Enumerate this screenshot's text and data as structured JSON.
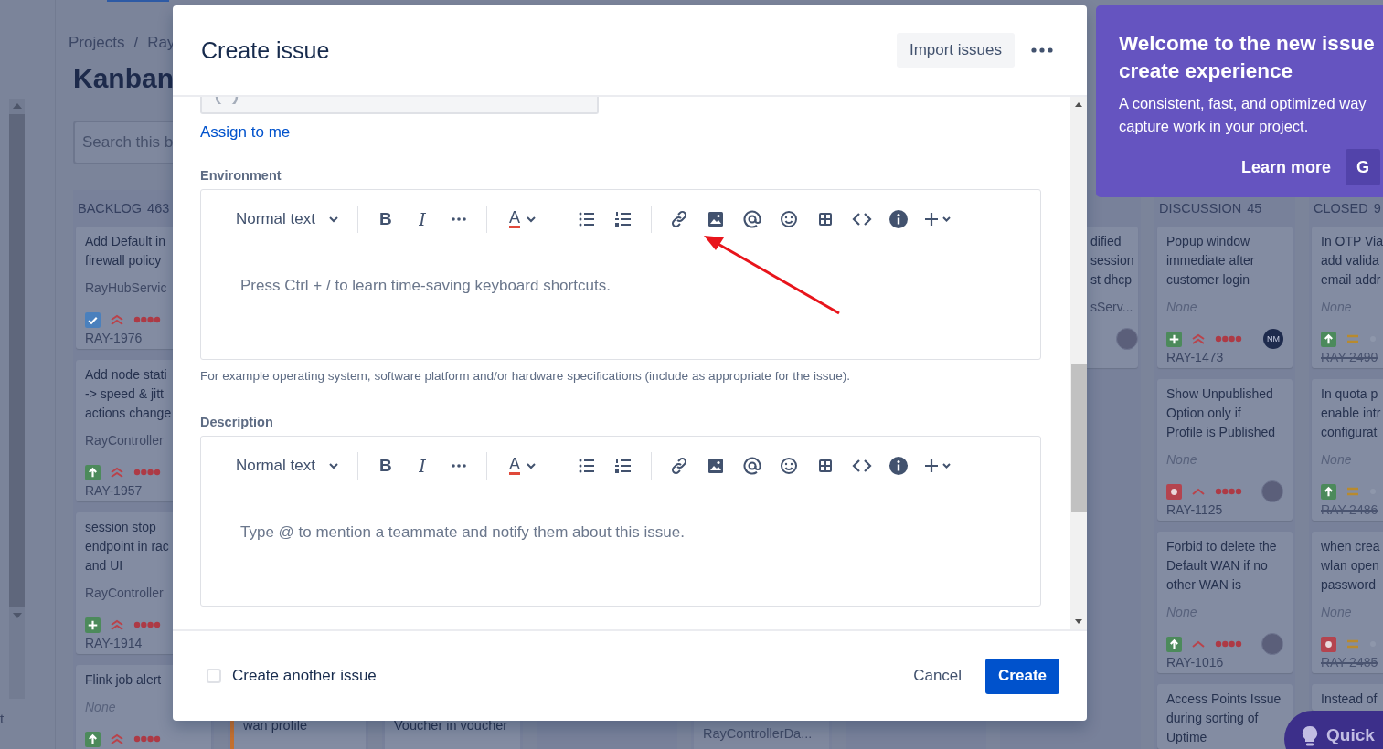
{
  "board": {
    "sidebar_fragment": "t",
    "breadcrumbs": [
      "Projects",
      "/",
      "Ray"
    ],
    "title": "Kanban",
    "search": {
      "placeholder": "Search this b"
    },
    "backlog": {
      "name": "BACKLOG",
      "count": "463",
      "cards": [
        {
          "lines": [
            "Add Default in",
            "firewall policy"
          ],
          "component": "RayHubServic",
          "component_missing": false,
          "icons": [
            {
              "kind": "task"
            },
            {
              "kind": "highest"
            },
            {
              "kind": "red_dots"
            }
          ],
          "key": "RAY-1976",
          "done": false
        },
        {
          "lines": [
            "Add node stati",
            "-> speed & jitt",
            "actions change"
          ],
          "component": "RayController",
          "component_missing": false,
          "icons": [
            {
              "kind": "improvement"
            },
            {
              "kind": "highest"
            },
            {
              "kind": "red_dots"
            }
          ],
          "key": "RAY-1957",
          "done": false
        },
        {
          "lines": [
            "session stop",
            "endpoint in rac",
            "and UI"
          ],
          "component": "RayController",
          "component_missing": false,
          "icons": [
            {
              "kind": "new_feature"
            },
            {
              "kind": "highest"
            },
            {
              "kind": "red_dots"
            }
          ],
          "key": "RAY-1914",
          "done": false
        },
        {
          "lines": [
            "Flink job alert"
          ],
          "component": "None",
          "component_missing": true,
          "icons": [
            {
              "kind": "improvement"
            },
            {
              "kind": "highest"
            },
            {
              "kind": "red_dots"
            }
          ]
        }
      ]
    },
    "covered_columns": [
      {
        "cards": [
          {
            "kind": "title",
            "text": "wan profile",
            "color": "#c4702f"
          }
        ]
      },
      {
        "cards": [
          {
            "kind": "title",
            "text": "Voucher in voucher"
          }
        ]
      },
      {},
      {
        "cards": [
          {
            "kind": "component",
            "text": "RayControllerDa..."
          }
        ]
      },
      {}
    ],
    "partial_column": {
      "cards": [
        {
          "lines": [
            "dified",
            "session",
            "st dhcp"
          ],
          "component": "sServ...",
          "component_missing": false,
          "avatar": {
            "kind": "photo"
          }
        }
      ]
    },
    "discussion": {
      "name": "DISCUSSION",
      "count": "45",
      "cards": [
        {
          "lines": [
            "Popup window",
            "immediate after",
            "customer login"
          ],
          "component": "None",
          "component_missing": true,
          "icons": [
            {
              "kind": "new_feature"
            },
            {
              "kind": "highest"
            },
            {
              "kind": "red_dots"
            }
          ],
          "avatar": {
            "kind": "initials",
            "text": "NM"
          },
          "key": "RAY-1473",
          "done": false
        },
        {
          "lines": [
            "Show Unpublished",
            "Option only if",
            "Profile is Published"
          ],
          "component": "None",
          "component_missing": true,
          "icons": [
            {
              "kind": "bug"
            },
            {
              "kind": "high"
            },
            {
              "kind": "red_dots"
            }
          ],
          "avatar": {
            "kind": "photo"
          },
          "key": "RAY-1125",
          "done": false
        },
        {
          "lines": [
            "Forbid to delete the",
            "Default WAN if no",
            "other WAN is"
          ],
          "component": "None",
          "component_missing": true,
          "icons": [
            {
              "kind": "improvement"
            },
            {
              "kind": "high"
            },
            {
              "kind": "red_dots"
            }
          ],
          "avatar": {
            "kind": "photo"
          },
          "key": "RAY-1016",
          "done": false
        },
        {
          "lines": [
            "Access Points Issue",
            "during sorting of",
            "Uptime"
          ]
        }
      ]
    },
    "closed": {
      "name": "CLOSED",
      "count": "9",
      "cards": [
        {
          "lines": [
            "In OTP Via",
            "add valida",
            "email addr"
          ],
          "component": "None",
          "component_missing": true,
          "icons": [
            {
              "kind": "improvement"
            },
            {
              "kind": "medium"
            },
            {
              "kind": "grey_dot"
            }
          ],
          "key": "RAY-2490",
          "done": true
        },
        {
          "lines": [
            "In quota p",
            "enable intr",
            "configurat"
          ],
          "component": "None",
          "component_missing": true,
          "icons": [
            {
              "kind": "improvement"
            },
            {
              "kind": "medium"
            },
            {
              "kind": "grey_dot"
            }
          ],
          "key": "RAY-2486",
          "done": true
        },
        {
          "lines": [
            "when crea",
            "wlan open",
            "password"
          ],
          "component": "None",
          "component_missing": true,
          "icons": [
            {
              "kind": "bug"
            },
            {
              "kind": "medium"
            },
            {
              "kind": "grey_dot"
            }
          ],
          "key": "RAY-2485",
          "done": true
        },
        {
          "lines": [
            "Instead of"
          ]
        }
      ]
    }
  },
  "modal": {
    "title": "Create issue",
    "import_button": "Import issues",
    "assign_link": "Assign to me",
    "editors": [
      {
        "label": "Environment",
        "toolbar": {
          "style": "Normal text",
          "bold": "B",
          "italic": "I",
          "text_color": "A"
        },
        "placeholder": "Press Ctrl + / to learn time-saving keyboard shortcuts.",
        "helper": "For example operating system, software platform and/or hardware specifications (include as appropriate for the issue)."
      },
      {
        "label": "Description",
        "toolbar": {
          "style": "Normal text",
          "bold": "B",
          "italic": "I",
          "text_color": "A"
        },
        "placeholder": "Type @ to mention a teammate and notify them about this issue."
      }
    ],
    "footer": {
      "another": {
        "label": "Create another issue",
        "checked": false
      },
      "cancel": "Cancel",
      "create": "Create"
    }
  },
  "welcome": {
    "title_lines": [
      "Welcome to the new issue",
      "create experience"
    ],
    "body_lines": [
      "A consistent, fast, and optimized way",
      "capture work in your project."
    ],
    "learn_more": "Learn more",
    "next_button": "G"
  },
  "quick_button": "Quick"
}
